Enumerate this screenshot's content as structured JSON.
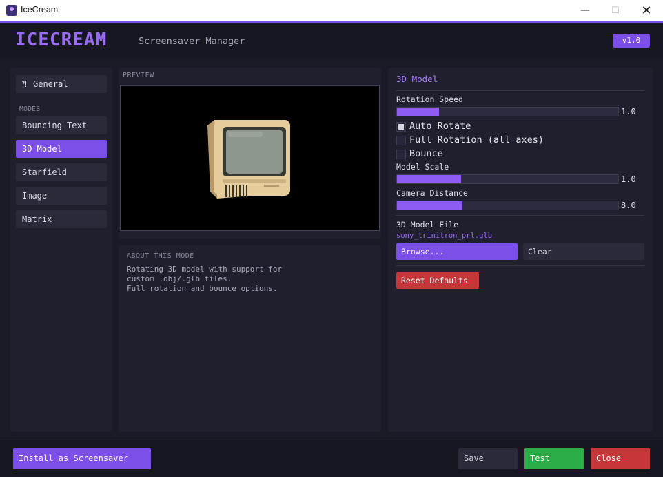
{
  "window": {
    "title": "IceCream"
  },
  "header": {
    "logo": "ICECREAM",
    "subtitle": "Screensaver Manager",
    "version": "v1.0"
  },
  "sidebar": {
    "general_label": "General",
    "section_label": "MODES",
    "modes": [
      {
        "label": "Bouncing Text"
      },
      {
        "label": "3D Model"
      },
      {
        "label": "Starfield"
      },
      {
        "label": "Image"
      },
      {
        "label": "Matrix"
      }
    ],
    "selected": "3D Model"
  },
  "preview": {
    "caption": "PREVIEW"
  },
  "about": {
    "caption": "ABOUT THIS MODE",
    "text": "Rotating 3D model with support for\ncustom .obj/.glb files.\nFull rotation and bounce options."
  },
  "settings": {
    "title": "3D Model",
    "rotation_speed": {
      "label": "Rotation Speed",
      "value": "1.0",
      "fill_fraction": 0.19
    },
    "auto_rotate": {
      "label": "Auto Rotate",
      "checked": true
    },
    "full_rotation": {
      "label": "Full Rotation (all axes)",
      "checked": false
    },
    "bounce": {
      "label": "Bounce",
      "checked": false
    },
    "model_scale": {
      "label": "Model Scale",
      "value": "1.0",
      "fill_fraction": 0.29
    },
    "camera_distance": {
      "label": "Camera Distance",
      "value": "8.0",
      "fill_fraction": 0.295
    },
    "model_file": {
      "label": "3D Model File",
      "filename": "sony_trinitron_prl.glb"
    },
    "browse_label": "Browse...",
    "clear_label": "Clear",
    "reset_label": "Reset Defaults"
  },
  "footer": {
    "install_label": "Install as Screensaver",
    "save_label": "Save",
    "test_label": "Test",
    "close_label": "Close"
  },
  "colors": {
    "accent": "#7b4fe8",
    "success": "#2aad46",
    "danger": "#c6373a",
    "background": "#1a1a27",
    "panel": "#1f1f2e"
  }
}
